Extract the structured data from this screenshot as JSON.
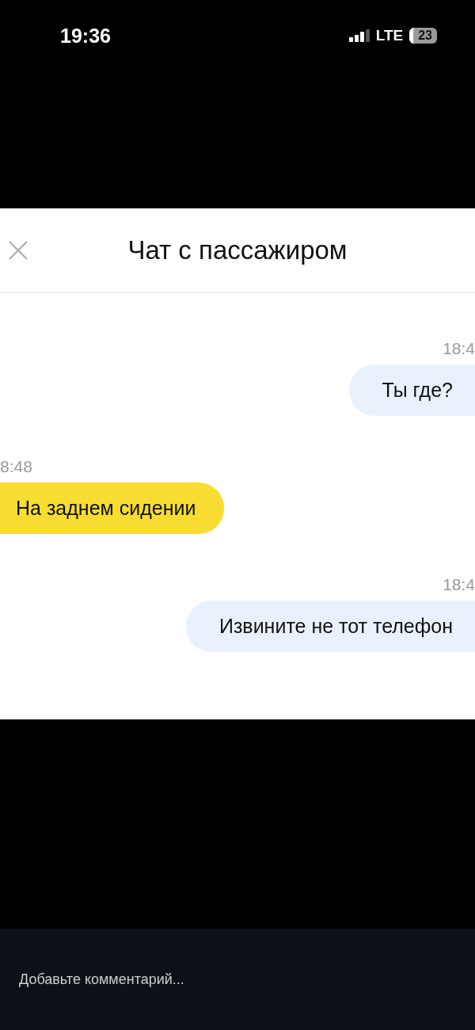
{
  "status_bar": {
    "time": "19:36",
    "network": "LTE",
    "battery": "23"
  },
  "chat": {
    "title": "Чат с пассажиром",
    "messages": [
      {
        "kind": "sent",
        "time": "18:4",
        "text": "Ты где?"
      },
      {
        "kind": "received",
        "time": "8:48",
        "text": "На заднем сидении"
      },
      {
        "kind": "sent",
        "time": "18:4",
        "text": "Извините не тот телефон"
      }
    ]
  },
  "comment_field": {
    "placeholder": "Добавьте комментарий..."
  }
}
